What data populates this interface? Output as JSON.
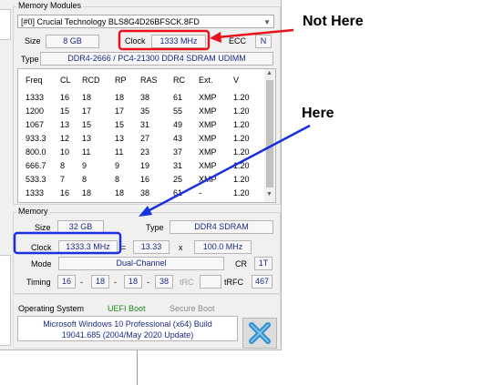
{
  "modules": {
    "group_title": "Memory Modules",
    "slot_selector": "[#0] Crucial Technology BLS8G4D26BFSCK.8FD",
    "size_label": "Size",
    "size_value": "8 GB",
    "clock_label": "Clock",
    "clock_value": "1333 MHz",
    "ecc_label": "ECC",
    "ecc_value": "N",
    "type_label": "Type",
    "type_value": "DDR4-2666 / PC4-21300 DDR4 SDRAM UDIMM",
    "timing_table": {
      "headers": [
        "Freq",
        "CL",
        "RCD",
        "RP",
        "RAS",
        "RC",
        "Ext.",
        "V"
      ],
      "rows": [
        [
          "1333",
          "16",
          "18",
          "18",
          "38",
          "61",
          "XMP",
          "1.20"
        ],
        [
          "1200",
          "15",
          "17",
          "17",
          "35",
          "55",
          "XMP",
          "1.20"
        ],
        [
          "1067",
          "13",
          "15",
          "15",
          "31",
          "49",
          "XMP",
          "1.20"
        ],
        [
          "933.3",
          "12",
          "13",
          "13",
          "27",
          "43",
          "XMP",
          "1.20"
        ],
        [
          "800.0",
          "10",
          "11",
          "11",
          "23",
          "37",
          "XMP",
          "1.20"
        ],
        [
          "666.7",
          "8",
          "9",
          "9",
          "19",
          "31",
          "XMP",
          "1.20"
        ],
        [
          "533.3",
          "7",
          "8",
          "8",
          "16",
          "25",
          "XMP",
          "1.20"
        ],
        [
          "1333",
          "16",
          "18",
          "18",
          "38",
          "61",
          "-",
          "1.20"
        ]
      ]
    }
  },
  "memory": {
    "group_title": "Memory",
    "size_label": "Size",
    "size_value": "32 GB",
    "type_label": "Type",
    "type_value": "DDR4 SDRAM",
    "clock_label": "Clock",
    "clock_value": "1333.3 MHz",
    "equals": "=",
    "multiplier": "13.33",
    "times": "x",
    "base_clock": "100.0 MHz",
    "mode_label": "Mode",
    "mode_value": "Dual-Channel",
    "cr_label": "CR",
    "cr_value": "1T",
    "timing_label": "Timing",
    "timings": [
      "16",
      "18",
      "18",
      "38"
    ],
    "dash": "-",
    "trc_label": "tRC",
    "trc_value": "",
    "trfc_label": "tRFC",
    "trfc_value": "467"
  },
  "os": {
    "label": "Operating System",
    "uefi_boot": "UEFI Boot",
    "secure_boot": "Secure Boot",
    "description_line1": "Microsoft Windows 10 Professional (x64) Build",
    "description_line2": "19041.685 (2004/May 2020 Update)"
  },
  "annotations": {
    "not_here": "Not Here",
    "here": "Here",
    "colors": {
      "red": "#e8121c",
      "blue": "#1a2fe0"
    }
  },
  "colors": {
    "value_text": "#1c2a83",
    "uefi_green": "#1a8a1a",
    "x_icon": "#2f8fd0"
  }
}
